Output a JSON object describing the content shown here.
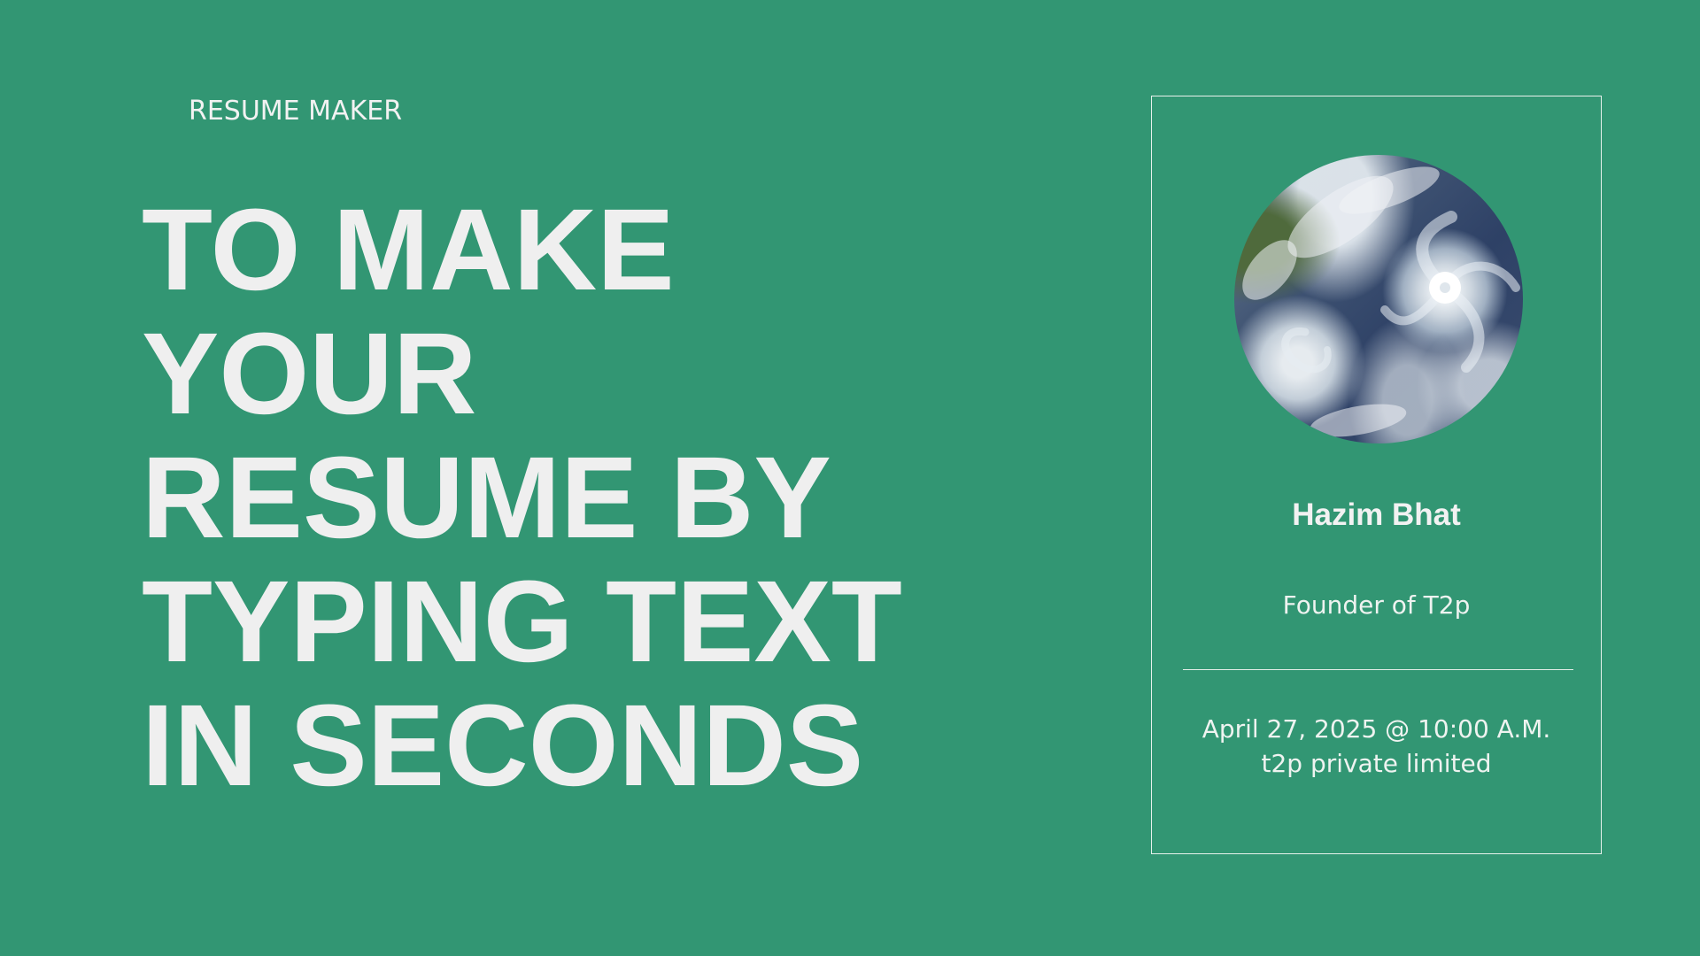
{
  "eyebrow": "RESUME MAKER",
  "headline": {
    "lines": [
      "TO MAKE",
      "YOUR",
      "RESUME BY",
      "TYPING TEXT",
      "IN SECONDS"
    ]
  },
  "card": {
    "avatar_icon": "satellite-storm-photo",
    "name": "Hazim Bhat",
    "role": "Founder of T2p",
    "date": "April 27, 2025 @ 10:00 A.M.",
    "org": "t2p private limited"
  },
  "colors": {
    "background": "#329673",
    "text": "#f0f0f0",
    "border": "#e8f1ec"
  }
}
